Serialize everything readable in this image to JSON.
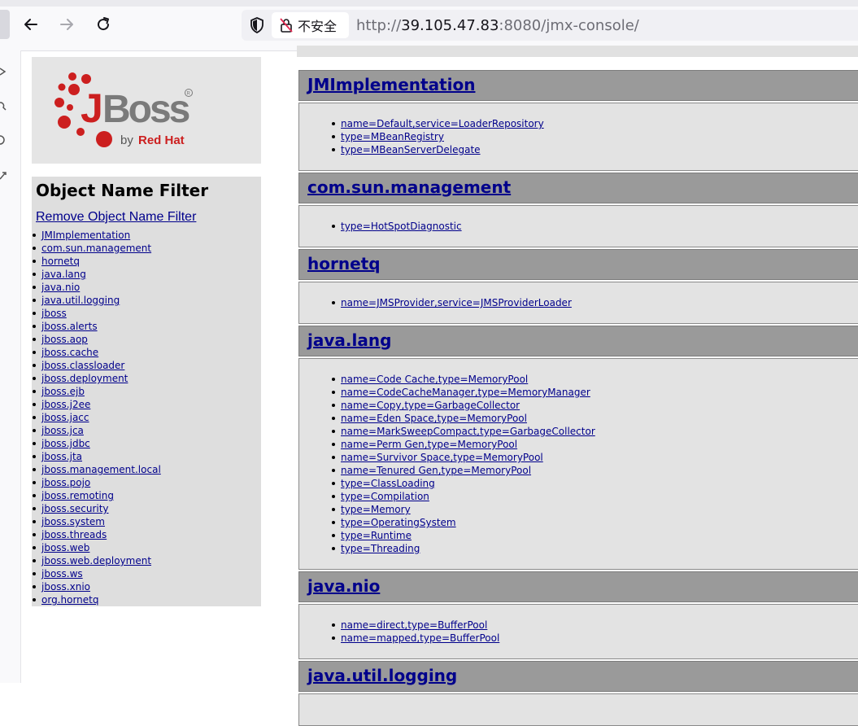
{
  "browser": {
    "security_label": "不安全",
    "url_host": "39.105.47.83",
    "url_rest": ":8080/jmx-console/",
    "url_prefix": "http://"
  },
  "logo": {
    "wordmark": "JBoss",
    "byline": "by Red Hat",
    "colors": {
      "brand_red": "#cc0000",
      "wordmark_gray": "#7a7a7a"
    }
  },
  "filter": {
    "title": "Object Name Filter",
    "remove_label": "Remove Object Name Filter",
    "domains": [
      "JMImplementation",
      "com.sun.management",
      "hornetq",
      "java.lang",
      "java.nio",
      "java.util.logging",
      "jboss",
      "jboss.alerts",
      "jboss.aop",
      "jboss.cache",
      "jboss.classloader",
      "jboss.deployment",
      "jboss.ejb",
      "jboss.j2ee",
      "jboss.jacc",
      "jboss.jca",
      "jboss.jdbc",
      "jboss.jta",
      "jboss.management.local",
      "jboss.pojo",
      "jboss.remoting",
      "jboss.security",
      "jboss.system",
      "jboss.threads",
      "jboss.web",
      "jboss.web.deployment",
      "jboss.ws",
      "jboss.xnio",
      "org.hornetq"
    ]
  },
  "sections": [
    {
      "name": "JMImplementation",
      "mbeans": [
        "name=Default,service=LoaderRepository",
        "type=MBeanRegistry",
        "type=MBeanServerDelegate"
      ]
    },
    {
      "name": "com.sun.management",
      "mbeans": [
        "type=HotSpotDiagnostic"
      ]
    },
    {
      "name": "hornetq",
      "mbeans": [
        "name=JMSProvider,service=JMSProviderLoader"
      ]
    },
    {
      "name": "java.lang",
      "mbeans": [
        "name=Code Cache,type=MemoryPool",
        "name=CodeCacheManager,type=MemoryManager",
        "name=Copy,type=GarbageCollector",
        "name=Eden Space,type=MemoryPool",
        "name=MarkSweepCompact,type=GarbageCollector",
        "name=Perm Gen,type=MemoryPool",
        "name=Survivor Space,type=MemoryPool",
        "name=Tenured Gen,type=MemoryPool",
        "type=ClassLoading",
        "type=Compilation",
        "type=Memory",
        "type=OperatingSystem",
        "type=Runtime",
        "type=Threading"
      ]
    },
    {
      "name": "java.nio",
      "mbeans": [
        "name=direct,type=BufferPool",
        "name=mapped,type=BufferPool"
      ]
    },
    {
      "name": "java.util.logging",
      "mbeans": []
    }
  ]
}
